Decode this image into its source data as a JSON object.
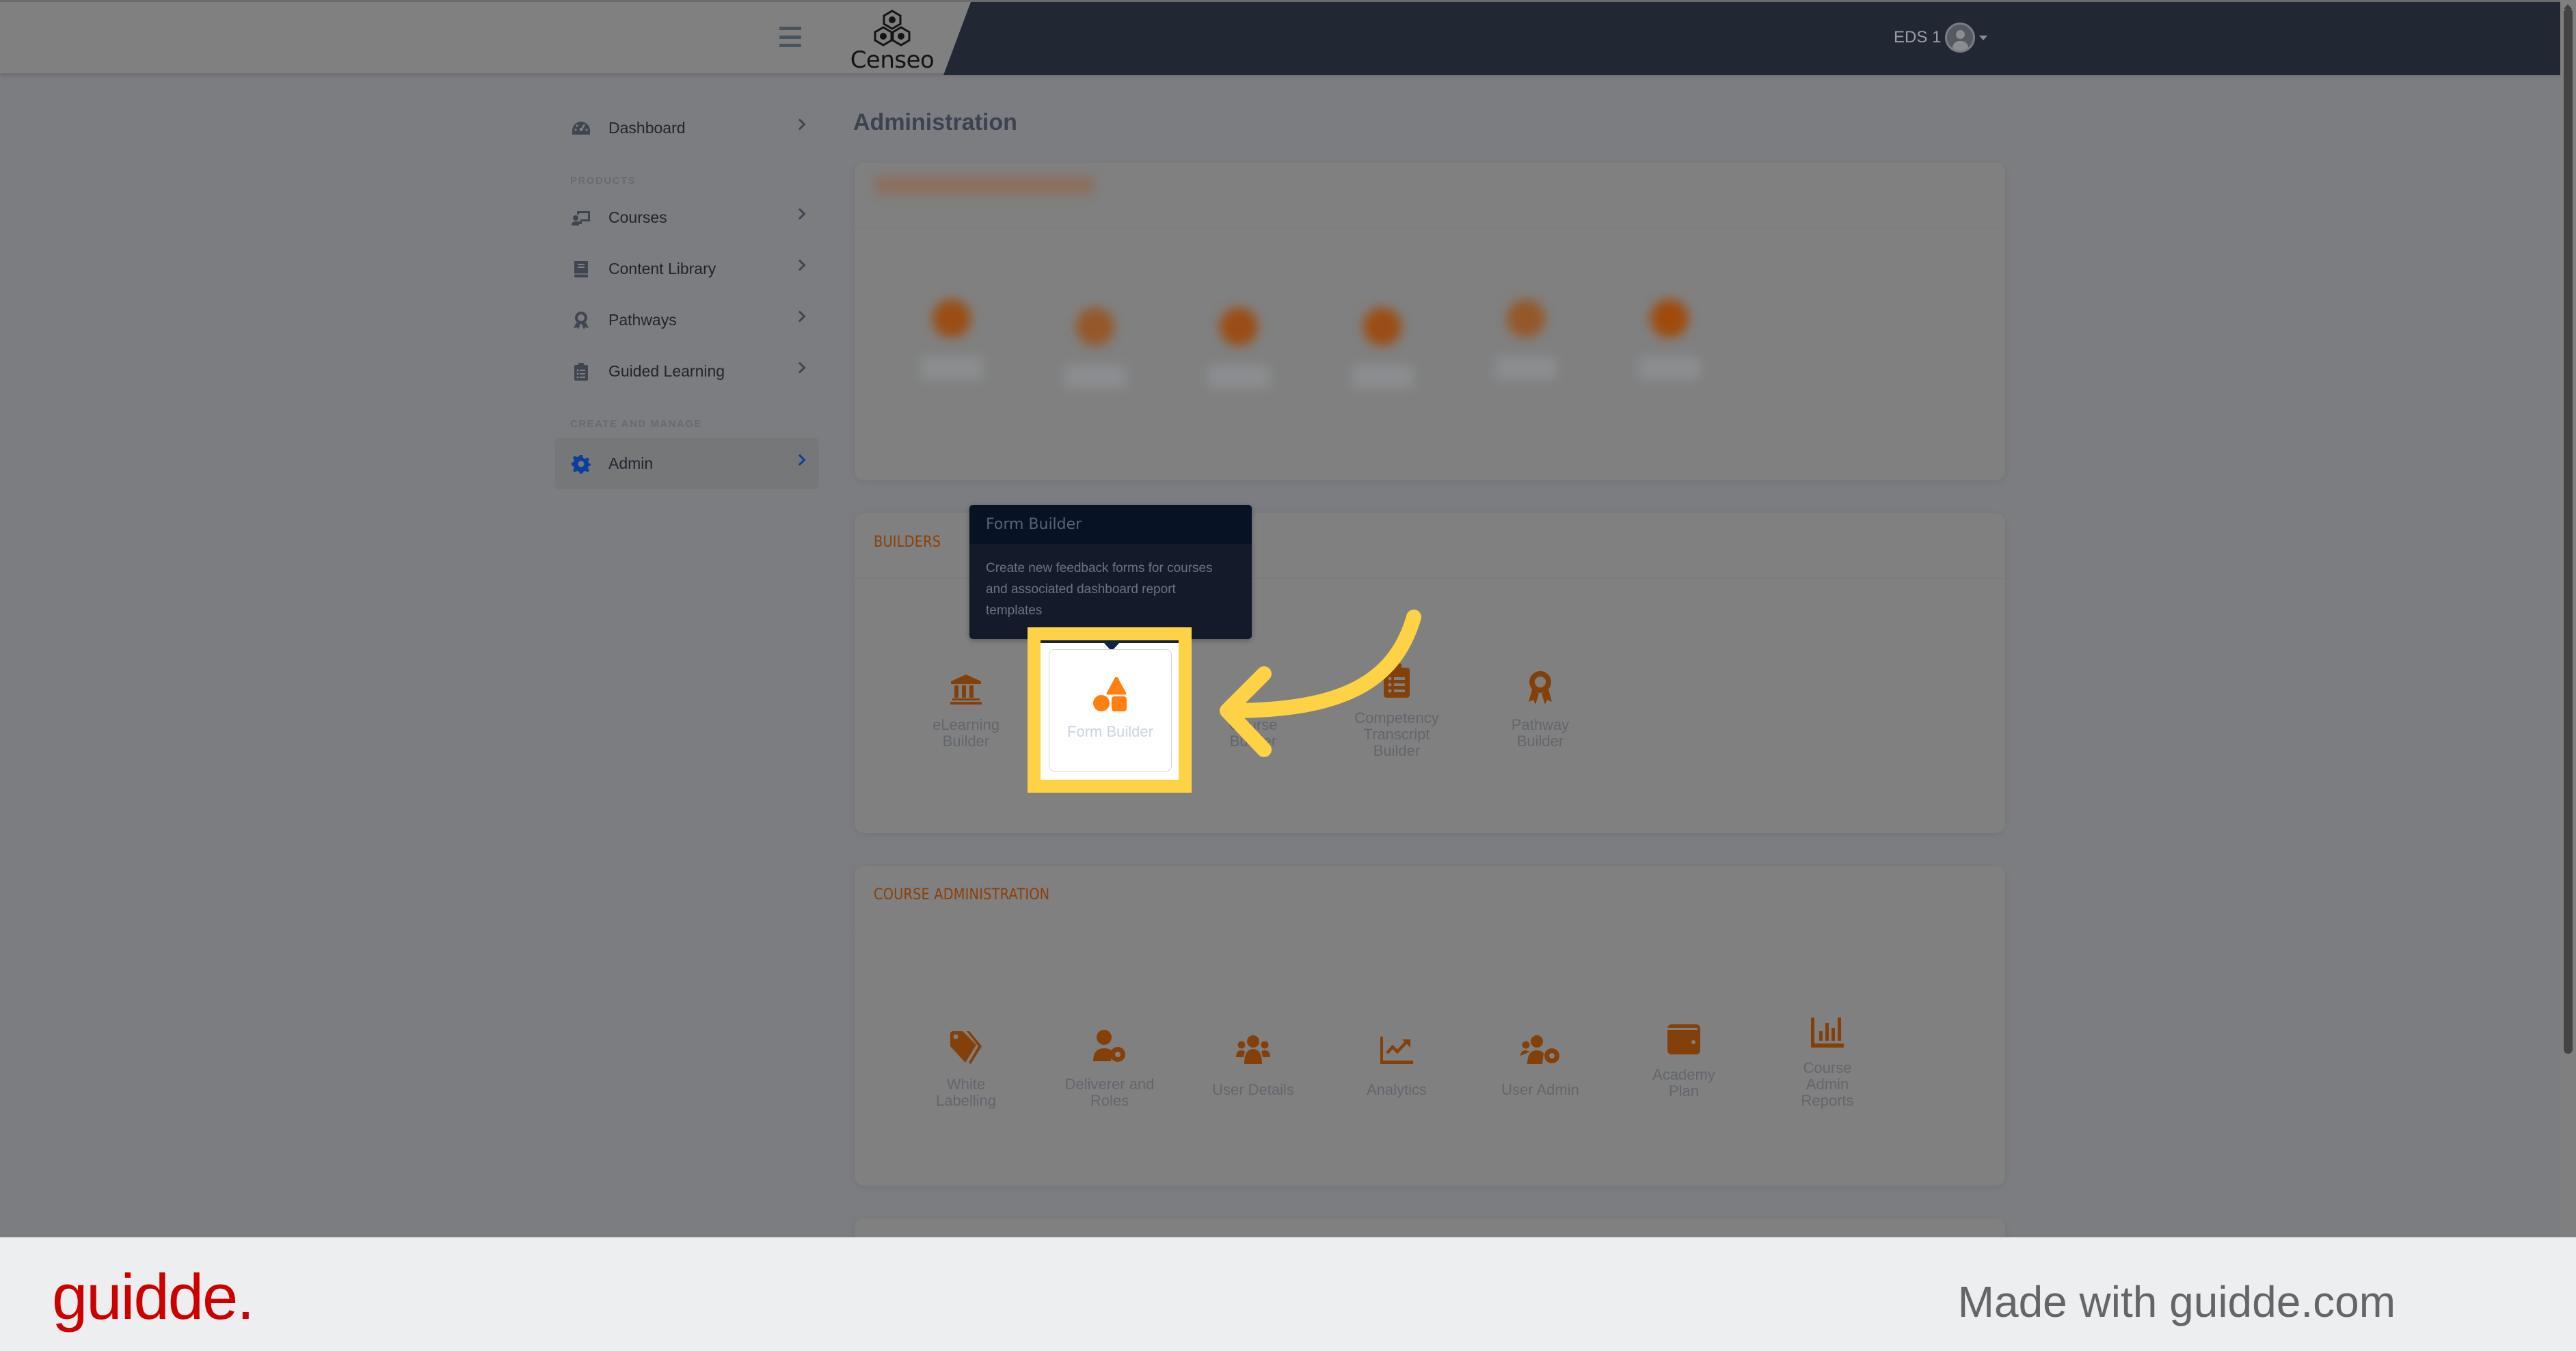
{
  "header": {
    "app_name": "Censeo",
    "user_name": "EDS 1"
  },
  "sidebar": {
    "items": [
      {
        "label": "Dashboard",
        "icon": "dashboard-gauge-icon"
      },
      {
        "section": "PRODUCTS"
      },
      {
        "label": "Courses",
        "icon": "chalkboard-teacher-icon"
      },
      {
        "label": "Content Library",
        "icon": "book-icon"
      },
      {
        "label": "Pathways",
        "icon": "award-icon"
      },
      {
        "label": "Guided Learning",
        "icon": "clipboard-list-icon"
      },
      {
        "section": "CREATE AND MANAGE"
      },
      {
        "label": "Admin",
        "icon": "gear-icon",
        "active": true
      }
    ]
  },
  "main": {
    "page_title": "Administration",
    "builders": {
      "title": "BUILDERS",
      "tiles": [
        {
          "label": "eLearning Builder",
          "icon": "institution-icon"
        },
        {
          "label": "Form Builder",
          "icon": "shapes-icon",
          "highlighted": true
        },
        {
          "label": "Course Builder",
          "icon": "ruler-pencil-icon"
        },
        {
          "label": "Competency Transcript Builder",
          "icon": "clipboard-list-icon"
        },
        {
          "label": "Pathway Builder",
          "icon": "award-icon"
        }
      ]
    },
    "course_admin": {
      "title": "COURSE ADMINISTRATION",
      "tiles": [
        {
          "label": "White Labelling",
          "icon": "tags-icon"
        },
        {
          "label": "Deliverer and Roles",
          "icon": "user-gear-icon"
        },
        {
          "label": "User Details",
          "icon": "users-icon"
        },
        {
          "label": "Analytics",
          "icon": "chart-line-icon"
        },
        {
          "label": "User Admin",
          "icon": "users-gear-icon"
        },
        {
          "label": "Academy Plan",
          "icon": "wallet-icon"
        },
        {
          "label": "Course Admin Reports",
          "icon": "chart-bar-icon"
        }
      ]
    },
    "tooltip": {
      "title": "Form Builder",
      "body": "Create new feedback forms for courses and associated dashboard report templates"
    }
  },
  "footer": {
    "brand": "guidde.",
    "made_with": "Made with guidde.com"
  },
  "colors": {
    "accent_orange": "#84400a",
    "highlight_yellow": "#fdd244",
    "header_dark": "#212833",
    "active_blue": "#0d3e9e",
    "brand_red": "#cc0000"
  }
}
